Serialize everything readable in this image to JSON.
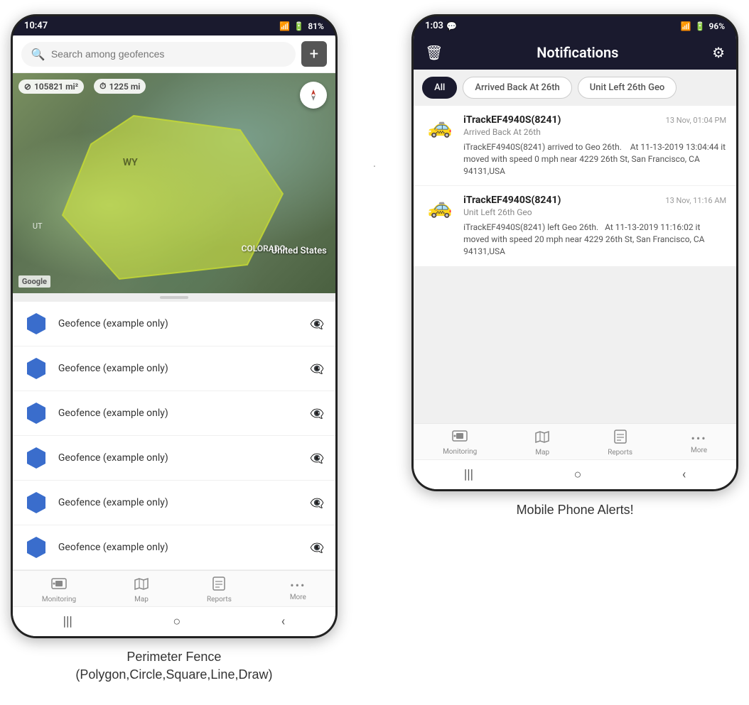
{
  "phone1": {
    "status": {
      "time": "10:47",
      "wifi": "📶",
      "battery": "81%"
    },
    "search": {
      "placeholder": "Search among geofences"
    },
    "map": {
      "area_sq": "105821 mi²",
      "distance": "1225 mi",
      "state_wy": "WY",
      "state_co": "COLORADO",
      "state_ut": "UT",
      "overlay_text": "United States",
      "google_label": "Google"
    },
    "geofences": [
      {
        "label": "Geofence (example only)"
      },
      {
        "label": "Geofence (example only)"
      },
      {
        "label": "Geofence (example only)"
      },
      {
        "label": "Geofence (example only)"
      },
      {
        "label": "Geofence (example only)"
      },
      {
        "label": "Geofence (example only)"
      }
    ],
    "nav": {
      "items": [
        {
          "icon": "🚌",
          "label": "Monitoring"
        },
        {
          "icon": "🗺",
          "label": "Map"
        },
        {
          "icon": "📊",
          "label": "Reports"
        },
        {
          "icon": "•••",
          "label": "More"
        }
      ]
    },
    "android_nav": [
      "|||",
      "○",
      "‹"
    ]
  },
  "phone2": {
    "status": {
      "time": "1:03",
      "chat_icon": "💬",
      "battery": "96%"
    },
    "header": {
      "title": "Notifications",
      "delete_icon": "🗑",
      "settings_icon": "⚙"
    },
    "filters": [
      {
        "label": "All",
        "active": true
      },
      {
        "label": "Arrived Back At 26th",
        "active": false
      },
      {
        "label": "Unit Left 26th Geo",
        "active": false
      }
    ],
    "notifications": [
      {
        "device": "iTrackEF4940S(8241)",
        "time": "13 Nov, 01:04 PM",
        "event": "Arrived Back At 26th",
        "body": "iTrackEF4940S(8241) arrived to Geo 26th.    At 11-13-2019 13:04:44 it moved with speed 0 mph near 4229 26th St, San Francisco, CA 94131,USA"
      },
      {
        "device": "iTrackEF4940S(8241)",
        "time": "13 Nov, 11:16 AM",
        "event": "Unit Left 26th Geo",
        "body": "iTrackEF4940S(8241) left Geo 26th.   At 11-13-2019 11:16:02 it moved with speed 20 mph near 4229 26th St, San Francisco, CA 94131,USA"
      }
    ],
    "nav": {
      "items": [
        {
          "icon": "🚌",
          "label": "Monitoring"
        },
        {
          "icon": "🗺",
          "label": "Map"
        },
        {
          "icon": "📊",
          "label": "Reports"
        },
        {
          "icon": "•••",
          "label": "More"
        }
      ]
    },
    "android_nav": [
      "|||",
      "○",
      "‹"
    ]
  },
  "captions": {
    "left": "Perimeter Fence\n(Polygon,Circle,Square,Line,Draw)",
    "right": "Mobile Phone Alerts!"
  }
}
